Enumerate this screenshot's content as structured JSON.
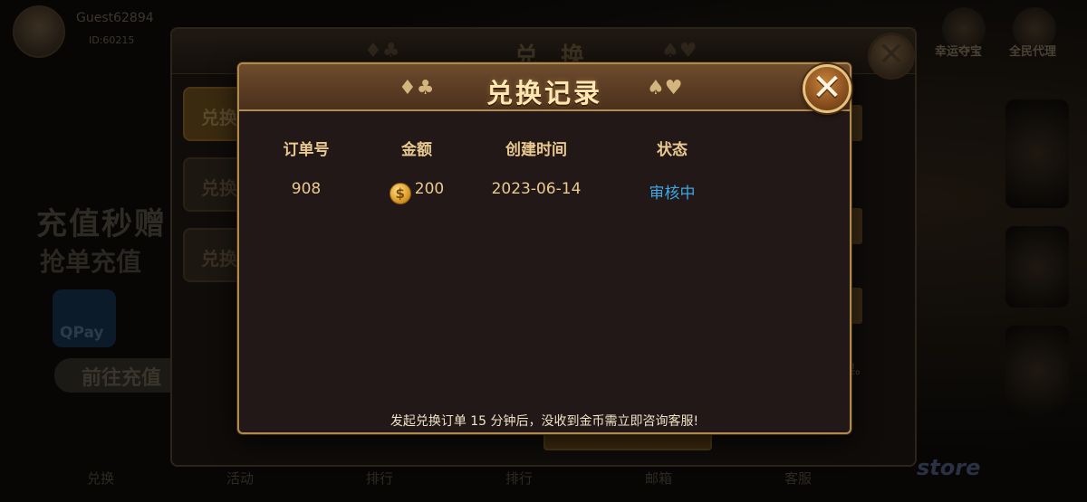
{
  "background": {
    "user": {
      "name": "Guest62894",
      "id_text": "ID:60215"
    },
    "top_icons": [
      {
        "label": "幸运夺宝",
        "icon": "treasure-icon"
      },
      {
        "label": "全民代理",
        "icon": "agent-icon"
      }
    ],
    "promo": {
      "line1": "充值秒赠",
      "line2": "抢单充值",
      "qpay_label": "QPay",
      "goto_label": "前往充值"
    },
    "bottom_nav": [
      {
        "label": "兑换",
        "icon": "exchange-icon"
      },
      {
        "label": "活动",
        "icon": "activity-icon"
      },
      {
        "label": "排行",
        "icon": "rank-icon"
      },
      {
        "label": "排行",
        "icon": "rank2-icon"
      },
      {
        "label": "邮箱",
        "icon": "mail-icon"
      },
      {
        "label": "客服",
        "icon": "service-icon"
      }
    ],
    "store_label": "store"
  },
  "exchange_panel": {
    "title": "兑 换",
    "tabs": [
      "兑换",
      "兑换",
      "兑换"
    ],
    "note": "误。"
  },
  "record_modal": {
    "title": "兑换记录",
    "suits_left": "♦♣",
    "suits_right": "♠♥",
    "close_glyph": "✕",
    "columns": [
      "订单号",
      "金额",
      "创建时间",
      "状态"
    ],
    "rows": [
      {
        "order_no": "908",
        "amount": "200",
        "created": "2023-06-14",
        "status": "审核中",
        "coin_icon": "coin-icon"
      }
    ],
    "footer_note": "发起兑换订单 15 分钟后，没收到金币需立即咨询客服!"
  },
  "colors": {
    "accent_gold": "#e9c98f",
    "status_blue": "#3ea7e6",
    "modal_bg": "#221817",
    "header_brown": "#5a3c23"
  }
}
